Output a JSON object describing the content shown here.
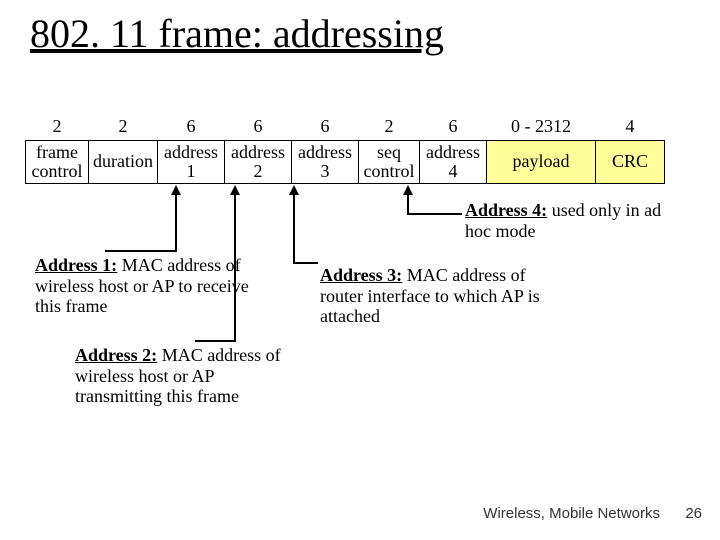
{
  "title": "802. 11 frame: addressing",
  "bytes": [
    "2",
    "2",
    "6",
    "6",
    "6",
    "2",
    "6",
    "0 - 2312",
    "4"
  ],
  "fields": {
    "frame_control": "frame\ncontrol",
    "duration": "duration",
    "addr1": "address\n1",
    "addr2": "address\n2",
    "addr3": "address\n3",
    "seq": "seq\ncontrol",
    "addr4": "address\n4",
    "payload": "payload",
    "crc": "CRC"
  },
  "notes": {
    "a1": {
      "label": "Address 1:",
      "text": " MAC address of wireless host or AP to receive this frame"
    },
    "a2": {
      "label": "Address 2:",
      "text": " MAC address of wireless host or AP transmitting this frame"
    },
    "a3": {
      "label": "Address 3:",
      "text": " MAC address of router interface to which AP is attached"
    },
    "a4": {
      "label": "Address 4:",
      "text": " used only in ad hoc mode"
    }
  },
  "footer": "Wireless, Mobile Networks",
  "page": "26"
}
